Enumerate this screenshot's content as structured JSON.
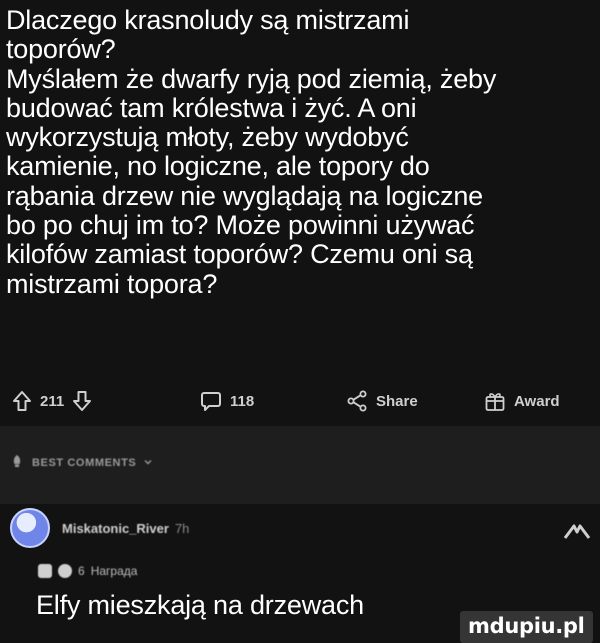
{
  "post": {
    "lines": [
      "Dlaczego krasnoludy są mistrzami",
      "toporów?",
      "Myślałem że dwarfy ryją pod ziemią, żeby",
      "budować tam królestwa i żyć. A oni",
      "wykorzystują młoty, żeby wydobyć",
      "kamienie, no logiczne, ale topory do",
      "rąbania drzew nie wyglądają na logiczne",
      "bo po chuj im to? Może powinni używać",
      "kilofów zamiast toporów? Czemu oni są",
      "mistrzami topora?"
    ]
  },
  "actions": {
    "vote_count": "211",
    "comment_count": "118",
    "share_label": "Share",
    "award_label": "Award"
  },
  "comments_section": {
    "sort_label": "BEST COMMENTS"
  },
  "comment": {
    "username": "Miskatonic_River",
    "age": "7h",
    "award_count": "6",
    "award_name": "Награда",
    "text": "Elfy mieszkają na drzewach"
  },
  "watermark": "mdupiu.pl",
  "colors": {
    "background": "#121212",
    "band": "#1e1e1e",
    "text": "#ffffff",
    "muted": "#cfcfcf",
    "avatar": "#6f86e8"
  }
}
